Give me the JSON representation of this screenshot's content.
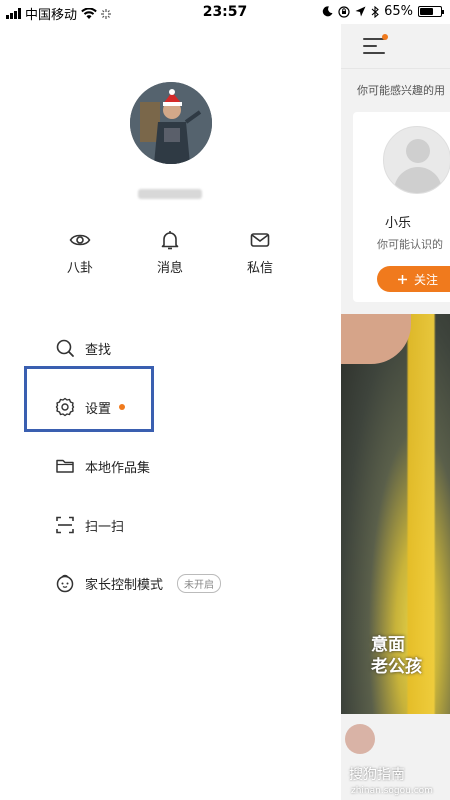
{
  "status_bar": {
    "carrier": "中国移动",
    "time": "23:57",
    "battery": "65%",
    "battery_level": 0.65
  },
  "profile": {
    "username": "",
    "avatar": "user-avatar"
  },
  "quick_actions": [
    {
      "label": "八卦",
      "icon": "eye-icon"
    },
    {
      "label": "消息",
      "icon": "bell-icon"
    },
    {
      "label": "私信",
      "icon": "mail-icon"
    }
  ],
  "menu": {
    "search": "查找",
    "settings": "设置",
    "local_collection": "本地作品集",
    "scan": "扫一扫",
    "parental_control": "家长控制模式",
    "parental_status": "未开启"
  },
  "peek_panel": {
    "section_title": "你可能感兴趣的用",
    "card": {
      "name": "小乐",
      "subtitle": "你可能认识的",
      "follow_label": "关注"
    },
    "video_overlay_line1": "意面",
    "video_overlay_line2": "老公孩",
    "watermark": "搜狗指南",
    "watermark_url": "zhinan.sogou.com"
  },
  "colors": {
    "accent": "#f07a1d",
    "highlight_box": "#3a5fb0"
  }
}
